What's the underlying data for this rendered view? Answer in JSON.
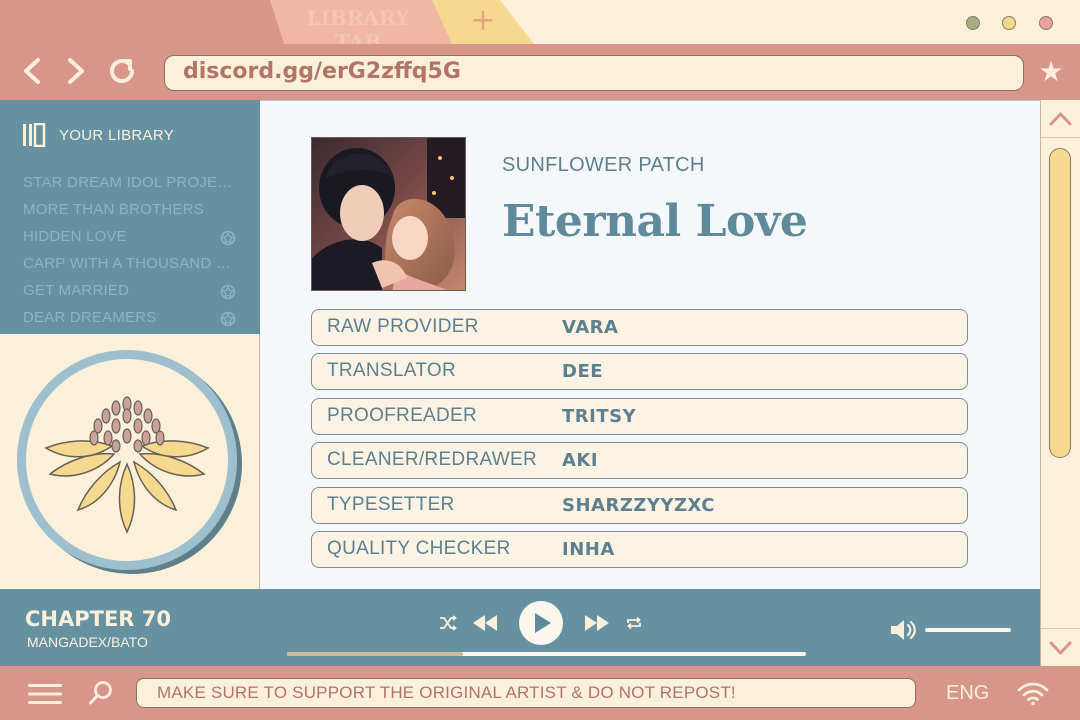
{
  "browser": {
    "active_tab_label": "LIBRARY TAB",
    "new_tab_label": "+",
    "window_dots": [
      "#a7ad7e",
      "#f1d98a",
      "#e9a39a"
    ],
    "url": "discord.gg/erG2zffq5G"
  },
  "sidebar": {
    "title": "YOUR LIBRARY",
    "items": [
      {
        "label": "STAR DREAM IDOL PROJECT",
        "badge": false
      },
      {
        "label": "MORE THAN BROTHERS",
        "badge": false
      },
      {
        "label": "HIDDEN LOVE",
        "badge": true
      },
      {
        "label": "CARP WITH A THOUSAND EYES",
        "badge": false
      },
      {
        "label": "GET MARRIED",
        "badge": true
      },
      {
        "label": "DEAR DREAMERS",
        "badge": true
      }
    ]
  },
  "series": {
    "studio": "SUNFLOWER PATCH",
    "title": "Eternal Love",
    "credits": [
      {
        "role": "RAW PROVIDER",
        "name": "VARA"
      },
      {
        "role": "TRANSLATOR",
        "name": "DEE"
      },
      {
        "role": "PROOFREADER",
        "name": "TRITSY"
      },
      {
        "role": "CLEANER/REDRAWER",
        "name": "AKI"
      },
      {
        "role": "TYPESETTER",
        "name": "SHARZZYYZXC"
      },
      {
        "role": "QUALITY CHECKER",
        "name": "INHA"
      }
    ]
  },
  "player": {
    "chapter": "CHAPTER 70",
    "source": "MANGADEX/BATO",
    "progress": 0.34
  },
  "bottom": {
    "notice": "MAKE SURE TO SUPPORT THE ORIGINAL ARTIST & DO NOT REPOST!",
    "language": "ENG"
  },
  "colors": {
    "frame": "#d8958a",
    "panel_blue": "#6591a1",
    "cream": "#fbf0da",
    "accent_yellow": "#f5d98f"
  }
}
